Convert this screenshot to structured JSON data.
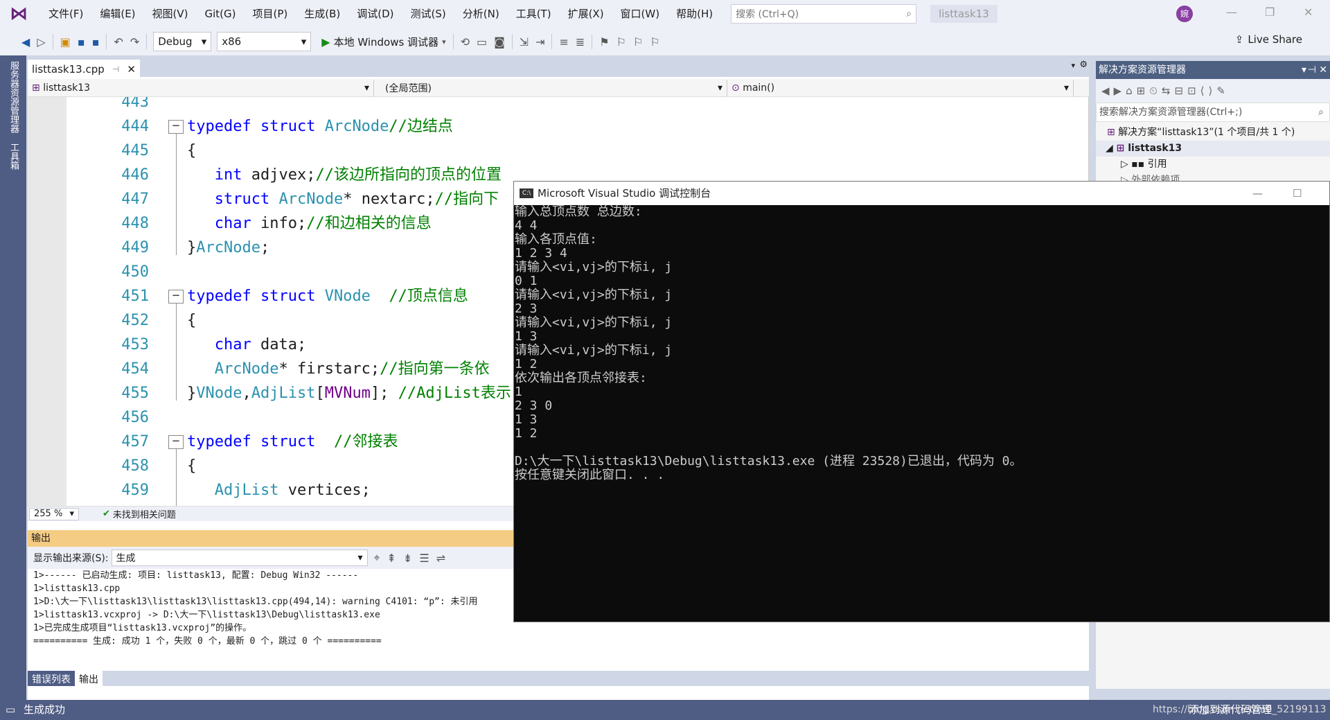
{
  "menu": [
    "文件(F)",
    "编辑(E)",
    "视图(V)",
    "Git(G)",
    "项目(P)",
    "生成(B)",
    "调试(D)",
    "测试(S)",
    "分析(N)",
    "工具(T)",
    "扩展(X)",
    "窗口(W)",
    "帮助(H)"
  ],
  "search_placeholder": "搜索 (Ctrl+Q)",
  "project_title": "listtask13",
  "avatar_text": "婉",
  "toolbar": {
    "config": "Debug",
    "platform": "x86",
    "run_label": "本地 Windows 调试器",
    "live_share": "Live Share"
  },
  "rail": {
    "server_explorer": "服务器资源管理器",
    "toolbox": "工具箱"
  },
  "editor": {
    "tab": "listtask13.cpp",
    "nav_project": "listtask13",
    "nav_scope": "(全局范围)",
    "nav_member": "main()",
    "lines": [
      {
        "n": "443",
        "html": ""
      },
      {
        "n": "444",
        "html": "<span class=\"kw\">typedef</span> <span class=\"kw\">struct</span> <span class=\"ty\">ArcNode</span><span class=\"cm\">//边结点</span>"
      },
      {
        "n": "445",
        "html": "{"
      },
      {
        "n": "446",
        "html": "   <span class=\"kw\">int</span> adjvex;<span class=\"cm\">//该边所指向的顶点的位置</span>"
      },
      {
        "n": "447",
        "html": "   <span class=\"kw\">struct</span> <span class=\"ty\">ArcNode</span>* nextarc;<span class=\"cm\">//指向下</span>"
      },
      {
        "n": "448",
        "html": "   <span class=\"kw\">char</span> info;<span class=\"cm\">//和边相关的信息</span>"
      },
      {
        "n": "449",
        "html": "}<span class=\"ty\">ArcNode</span>;"
      },
      {
        "n": "450",
        "html": ""
      },
      {
        "n": "451",
        "html": "<span class=\"kw\">typedef</span> <span class=\"kw\">struct</span> <span class=\"ty\">VNode</span>  <span class=\"cm\">//顶点信息</span>"
      },
      {
        "n": "452",
        "html": "{"
      },
      {
        "n": "453",
        "html": "   <span class=\"kw\">char</span> data;"
      },
      {
        "n": "454",
        "html": "   <span class=\"ty\">ArcNode</span>* firstarc;<span class=\"cm\">//指向第一条依</span>"
      },
      {
        "n": "455",
        "html": "}<span class=\"ty\">VNode</span>,<span class=\"ty\">AdjList</span>[<span class=\"mc\">MVNum</span>]; <span class=\"cm\">//AdjList表示</span>"
      },
      {
        "n": "456",
        "html": ""
      },
      {
        "n": "457",
        "html": "<span class=\"kw\">typedef</span> <span class=\"kw\">struct</span>  <span class=\"cm\">//邻接表</span>"
      },
      {
        "n": "458",
        "html": "{"
      },
      {
        "n": "459",
        "html": "   <span class=\"ty\">AdjList</span> vertices;"
      }
    ],
    "zoom": "255 %",
    "issues": "未找到相关问题"
  },
  "output": {
    "title": "输出",
    "source_label": "显示输出来源(S):",
    "source_value": "生成",
    "text": "1>------ 已启动生成: 项目: listtask13, 配置: Debug Win32 ------\n1>listtask13.cpp\n1>D:\\大一下\\listtask13\\listtask13\\listtask13.cpp(494,14): warning C4101: “p”: 未引用\n1>listtask13.vcxproj -> D:\\大一下\\listtask13\\Debug\\listtask13.exe\n1>已完成生成项目“listtask13.vcxproj”的操作。\n========== 生成: 成功 1 个，失败 0 个，最新 0 个，跳过 0 个 ==========",
    "tabs": [
      "错误列表",
      "输出"
    ]
  },
  "solution": {
    "title": "解决方案资源管理器",
    "search": "搜索解决方案资源管理器(Ctrl+;)",
    "items": [
      "解决方案“listtask13”(1 个项目/共 1 个)",
      "listtask13",
      "引用",
      "外部依赖项"
    ]
  },
  "console": {
    "title": "Microsoft Visual Studio 调试控制台",
    "text": "输入总顶点数 总边数:\n4 4\n输入各顶点值:\n1 2 3 4\n请输入<vi,vj>的下标i, j\n0 1\n请输入<vi,vj>的下标i, j\n2 3\n请输入<vi,vj>的下标i, j\n1 3\n请输入<vi,vj>的下标i, j\n1 2\n依次输出各顶点邻接表:\n1\n2 3 0\n1 3\n1 2\n\nD:\\大一下\\listtask13\\Debug\\listtask13.exe (进程 23528)已退出，代码为 0。\n按任意键关闭此窗口. . ."
  },
  "status": {
    "left": "生成成功",
    "right": "添加到源代码管理",
    "watermark": "https://blog.csdn.net/m0_52199113"
  }
}
